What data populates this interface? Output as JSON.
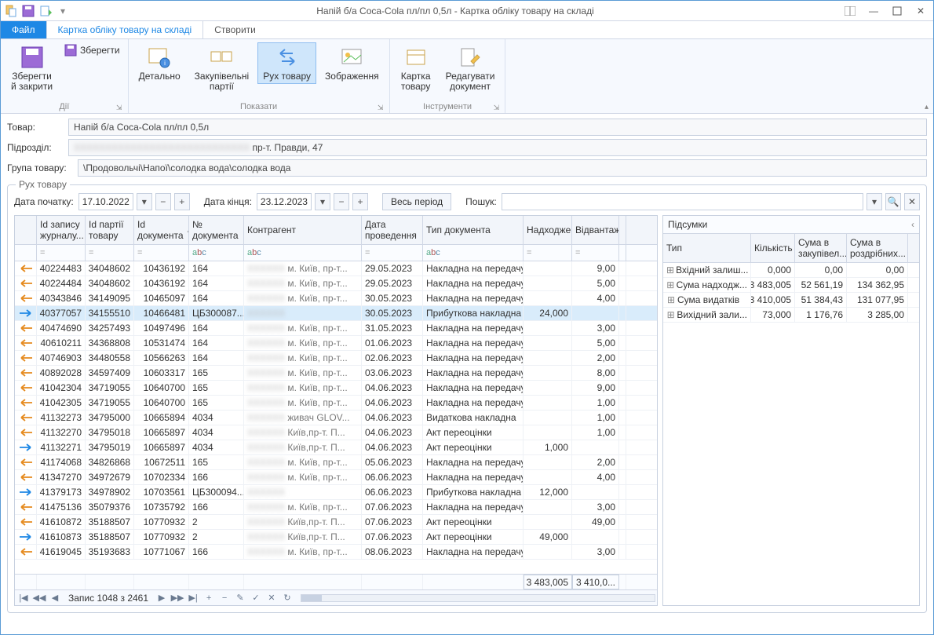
{
  "title": "Напій б/а Coca-Cola пл/пл 0,5л - Картка обліку товару на складі",
  "tabs": {
    "file": "Файл",
    "card": "Картка обліку товару на складі",
    "create": "Створити"
  },
  "ribbon": {
    "groups": {
      "actions": {
        "save_close": "Зберегти\nй закрити",
        "save": "Зберегти",
        "caption": "Дії"
      },
      "show": {
        "detail": "Детально",
        "lots": "Закупівельні\nпартії",
        "move": "Рух товару",
        "image": "Зображення",
        "caption": "Показати"
      },
      "tools": {
        "card": "Картка\nтовару",
        "edit": "Редагувати\nдокумент",
        "caption": "Інструменти"
      }
    }
  },
  "form": {
    "product_label": "Товар:",
    "product_value": "Напій б/а Coca-Cola пл/пл 0,5л",
    "dept_label": "Підрозділ:",
    "dept_value": "пр-т. Правди, 47",
    "group_label": "Група товару:",
    "group_value": "\\Продовольчі\\Напої\\солодка вода\\солодка вода"
  },
  "movement": {
    "legend": "Рух товару",
    "date_from_lbl": "Дата початку:",
    "date_from": "17.10.2022",
    "date_to_lbl": "Дата кінця:",
    "date_to": "23.12.2023",
    "full_period": "Весь період",
    "search_lbl": "Пошук:"
  },
  "columns": {
    "id": "Id запису журналу...",
    "lot": "Id партії товару",
    "docid": "Id документа",
    "docid_sort_hint": "▲",
    "docno": "№ документа",
    "contr": "Контрагент",
    "date": "Дата проведення",
    "type": "Тип документа",
    "in": "Надходження",
    "out": "Відвантаження"
  },
  "filter_row": {
    "eq": "=",
    "abc": "abc"
  },
  "rows": [
    {
      "dir": "out",
      "id": "40224483",
      "lot": "34048602",
      "docid": "10436192",
      "docno": "164",
      "contr": "м. Київ, пр-т...",
      "date": "29.05.2023",
      "type": "Накладна на передачу",
      "in": "",
      "out": "9,00"
    },
    {
      "dir": "out",
      "id": "40224484",
      "lot": "34048602",
      "docid": "10436192",
      "docno": "164",
      "contr": "м. Київ, пр-т...",
      "date": "29.05.2023",
      "type": "Накладна на передачу",
      "in": "",
      "out": "5,00"
    },
    {
      "dir": "out",
      "id": "40343846",
      "lot": "34149095",
      "docid": "10465097",
      "docno": "164",
      "contr": "м. Київ, пр-т...",
      "date": "30.05.2023",
      "type": "Накладна на передачу",
      "in": "",
      "out": "4,00"
    },
    {
      "dir": "in",
      "sel": true,
      "id": "40377057",
      "lot": "34155510",
      "docid": "10466481",
      "docno": "ЦБ300087...",
      "contr": "",
      "date": "30.05.2023",
      "type": "Прибуткова накладна",
      "in": "24,000",
      "out": ""
    },
    {
      "dir": "out",
      "id": "40474690",
      "lot": "34257493",
      "docid": "10497496",
      "docno": "164",
      "contr": "м. Київ, пр-т...",
      "date": "31.05.2023",
      "type": "Накладна на передачу",
      "in": "",
      "out": "3,00"
    },
    {
      "dir": "out",
      "id": "40610211",
      "lot": "34368808",
      "docid": "10531474",
      "docno": "164",
      "contr": "м. Київ, пр-т...",
      "date": "01.06.2023",
      "type": "Накладна на передачу",
      "in": "",
      "out": "5,00"
    },
    {
      "dir": "out",
      "id": "40746903",
      "lot": "34480558",
      "docid": "10566263",
      "docno": "164",
      "contr": "м. Київ, пр-т...",
      "date": "02.06.2023",
      "type": "Накладна на передачу",
      "in": "",
      "out": "2,00"
    },
    {
      "dir": "out",
      "id": "40892028",
      "lot": "34597409",
      "docid": "10603317",
      "docno": "165",
      "contr": "м. Київ, пр-т...",
      "date": "03.06.2023",
      "type": "Накладна на передачу",
      "in": "",
      "out": "8,00"
    },
    {
      "dir": "out",
      "id": "41042304",
      "lot": "34719055",
      "docid": "10640700",
      "docno": "165",
      "contr": "м. Київ, пр-т...",
      "date": "04.06.2023",
      "type": "Накладна на передачу",
      "in": "",
      "out": "9,00"
    },
    {
      "dir": "out",
      "id": "41042305",
      "lot": "34719055",
      "docid": "10640700",
      "docno": "165",
      "contr": "м. Київ, пр-т...",
      "date": "04.06.2023",
      "type": "Накладна на передачу",
      "in": "",
      "out": "1,00"
    },
    {
      "dir": "out",
      "id": "41132273",
      "lot": "34795000",
      "docid": "10665894",
      "docno": "4034",
      "contr": "живач GLOV...",
      "date": "04.06.2023",
      "type": "Видаткова накладна",
      "in": "",
      "out": "1,00"
    },
    {
      "dir": "out",
      "id": "41132270",
      "lot": "34795018",
      "docid": "10665897",
      "docno": "4034",
      "contr": "Київ,пр-т. П...",
      "date": "04.06.2023",
      "type": "Акт переоцінки",
      "in": "",
      "out": "1,00"
    },
    {
      "dir": "in",
      "id": "41132271",
      "lot": "34795019",
      "docid": "10665897",
      "docno": "4034",
      "contr": "Київ,пр-т. П...",
      "date": "04.06.2023",
      "type": "Акт переоцінки",
      "in": "1,000",
      "out": ""
    },
    {
      "dir": "out",
      "id": "41174068",
      "lot": "34826868",
      "docid": "10672511",
      "docno": "165",
      "contr": "м. Київ, пр-т...",
      "date": "05.06.2023",
      "type": "Накладна на передачу",
      "in": "",
      "out": "2,00"
    },
    {
      "dir": "out",
      "id": "41347270",
      "lot": "34972679",
      "docid": "10702334",
      "docno": "166",
      "contr": "м. Київ, пр-т...",
      "date": "06.06.2023",
      "type": "Накладна на передачу",
      "in": "",
      "out": "4,00"
    },
    {
      "dir": "in",
      "id": "41379173",
      "lot": "34978902",
      "docid": "10703561",
      "docno": "ЦБ300094...",
      "contr": "",
      "date": "06.06.2023",
      "type": "Прибуткова накладна",
      "in": "12,000",
      "out": ""
    },
    {
      "dir": "out",
      "id": "41475136",
      "lot": "35079376",
      "docid": "10735792",
      "docno": "166",
      "contr": "м. Київ, пр-т...",
      "date": "07.06.2023",
      "type": "Накладна на передачу",
      "in": "",
      "out": "3,00"
    },
    {
      "dir": "out",
      "id": "41610872",
      "lot": "35188507",
      "docid": "10770932",
      "docno": "2",
      "contr": "Київ,пр-т. П...",
      "date": "07.06.2023",
      "type": "Акт переоцінки",
      "in": "",
      "out": "49,00"
    },
    {
      "dir": "in",
      "id": "41610873",
      "lot": "35188507",
      "docid": "10770932",
      "docno": "2",
      "contr": "Київ,пр-т. П...",
      "date": "07.06.2023",
      "type": "Акт переоцінки",
      "in": "49,000",
      "out": ""
    },
    {
      "dir": "out",
      "id": "41619045",
      "lot": "35193683",
      "docid": "10771067",
      "docno": "166",
      "contr": "м. Київ, пр-т...",
      "date": "08.06.2023",
      "type": "Накладна на передачу",
      "in": "",
      "out": "3,00"
    }
  ],
  "totals": {
    "in": "3 483,005",
    "out": "3 410,0..."
  },
  "navigator": {
    "record": "Запис 1048 з 2461"
  },
  "side": {
    "title": "Підсумки",
    "cols": {
      "type": "Тип",
      "qty": "Кількість",
      "buy": "Сума в закупівел...",
      "ret": "Сума в роздрібних..."
    },
    "rows": [
      {
        "exp": "+",
        "type": "Вхідний залиш...",
        "qty": "0,000",
        "buy": "0,00",
        "ret": "0,00"
      },
      {
        "exp": "+",
        "type": "Сума надходж...",
        "qty": "3 483,005",
        "buy": "52 561,19",
        "ret": "134 362,95"
      },
      {
        "exp": "+",
        "type": "Сума видатків",
        "qty": "3 410,005",
        "buy": "51 384,43",
        "ret": "131 077,95"
      },
      {
        "exp": "+",
        "type": "Вихідний зали...",
        "qty": "73,000",
        "buy": "1 176,76",
        "ret": "3 285,00"
      }
    ]
  }
}
